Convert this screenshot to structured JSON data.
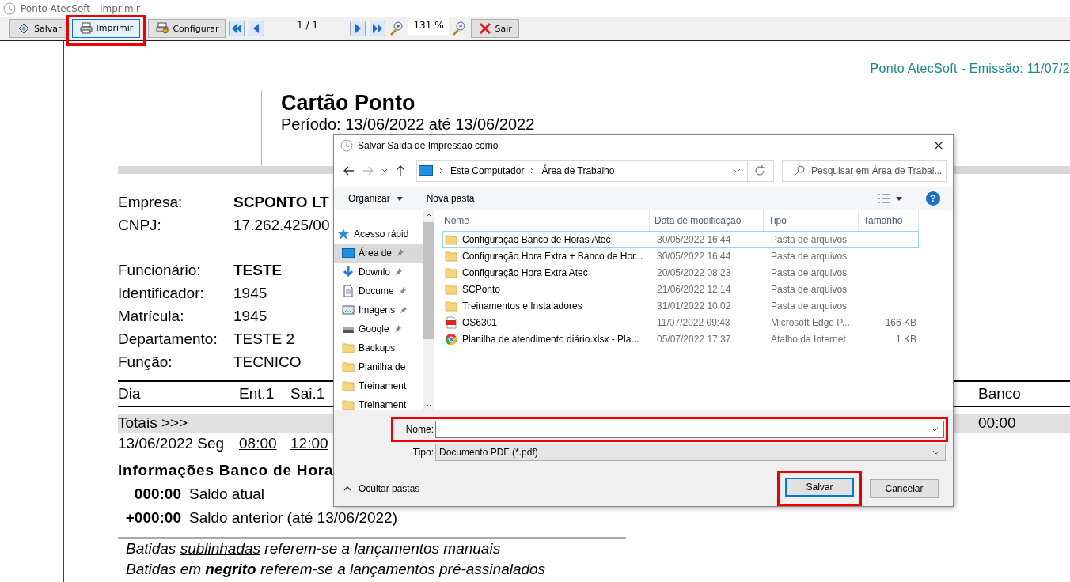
{
  "window": {
    "title": "Ponto AtecSoft - Imprimir"
  },
  "toolbar": [
    {
      "kind": "save",
      "label": "Salvar",
      "selected": false,
      "highlighted": false
    },
    {
      "kind": "print",
      "label": "Imprimir",
      "selected": true,
      "highlighted": true
    },
    {
      "kind": "configure",
      "label": "Configurar",
      "selected": false,
      "highlighted": false
    },
    {
      "kind": "first"
    },
    {
      "kind": "previous"
    },
    {
      "kind": "counter",
      "label": "1 / 1"
    },
    {
      "kind": "next"
    },
    {
      "kind": "last"
    },
    {
      "kind": "zoom_in"
    },
    {
      "kind": "zoom_level",
      "label": "131 %"
    },
    {
      "kind": "zoom_out"
    },
    {
      "kind": "exit",
      "label": "Sair",
      "selected": false,
      "highlighted": false
    }
  ],
  "report": {
    "emission": "Ponto AtecSoft - Emissão: 11/07/2",
    "title": "Cartão Ponto",
    "period": "Período: 13/06/2022 até 13/06/2022",
    "company": [
      {
        "label": "Empresa:",
        "value": "SCPONTO LT",
        "bold": true
      },
      {
        "label": "CNPJ:",
        "value": "17.262.425/00",
        "bold": false
      }
    ],
    "employee": [
      {
        "label": "Funcionário:",
        "value": "TESTE",
        "bold": true
      },
      {
        "label": "Identificador:",
        "value": "1945",
        "bold": false
      },
      {
        "label": "Matrícula:",
        "value": "1945",
        "bold": false
      },
      {
        "label": "Departamento:",
        "value": "TESTE 2",
        "bold": false
      },
      {
        "label": "Função:",
        "value": "TECNICO",
        "bold": false
      }
    ],
    "columns": [
      "Dia",
      "Ent.1",
      "Sai.1",
      "Banco"
    ],
    "totals": {
      "label": "Totais >>>",
      "bank": "00:00"
    },
    "rows": [
      {
        "day": "13/06/2022 Seg",
        "punches": [
          {
            "time": "08:00",
            "manual": true
          },
          {
            "time": "12:00",
            "manual": true
          }
        ]
      }
    ],
    "bank_heading": "Informações Banco de Hora",
    "balances": [
      {
        "amount": "000:00",
        "description": "Saldo atual"
      },
      {
        "amount": "+000:00",
        "description": "Saldo anterior (até 13/06/2022)"
      }
    ],
    "legend": [
      [
        {
          "text": "Batidas ",
          "underline": false
        },
        {
          "text": "sublinhadas",
          "underline": true
        },
        {
          "text": " referem-se a lançamentos manuais",
          "underline": false
        }
      ],
      [
        {
          "text": "Batidas em **negrito** referem-se a lançamentos pré-assinalados",
          "underline": false
        }
      ]
    ]
  },
  "dialog": {
    "title": "Salvar Saída de Impressão como",
    "path": [
      "Este Computador",
      "Área de Trabalho"
    ],
    "search": {
      "placeholder": "Pesquisar em Área de Trabal..."
    },
    "commands": [
      "Organizar",
      "Nova pasta"
    ],
    "help": "?",
    "nav": [
      {
        "kind": "quick_access",
        "label": "Acesso rápid",
        "pinned": false,
        "selected": false
      },
      {
        "kind": "desktop",
        "label": "Área de",
        "pinned": true,
        "selected": true
      },
      {
        "kind": "downloads",
        "label": "Downlo",
        "pinned": true,
        "selected": false
      },
      {
        "kind": "documents",
        "label": "Docume",
        "pinned": true,
        "selected": false
      },
      {
        "kind": "pictures",
        "label": "Imagens",
        "pinned": true,
        "selected": false
      },
      {
        "kind": "drive",
        "label": "Google",
        "pinned": true,
        "selected": false
      },
      {
        "kind": "folder",
        "label": "Backups",
        "pinned": false,
        "selected": false
      },
      {
        "kind": "folder",
        "label": "Planilha de",
        "pinned": false,
        "selected": false
      },
      {
        "kind": "folder",
        "label": "Treinament",
        "pinned": false,
        "selected": false
      },
      {
        "kind": "folder",
        "label": "Treinament",
        "pinned": false,
        "selected": false
      }
    ],
    "columns": [
      "Nome",
      "Data de modificação",
      "Tipo",
      "Tamanho"
    ],
    "files": [
      {
        "kind": "folder",
        "name": "Configuração Banco de Horas Atec",
        "date": "30/05/2022 16:44",
        "type": "Pasta de arquivos",
        "selected": true
      },
      {
        "kind": "folder",
        "name": "Configuração Hora Extra + Banco de Hor...",
        "date": "30/05/2022 16:44",
        "type": "Pasta de arquivos",
        "selected": false
      },
      {
        "kind": "folder",
        "name": "Configuração Hora Extra Atec",
        "date": "20/05/2022 08:23",
        "type": "Pasta de arquivos",
        "selected": false
      },
      {
        "kind": "folder",
        "name": "SCPonto",
        "date": "21/06/2022 12:14",
        "type": "Pasta de arquivos",
        "selected": false
      },
      {
        "kind": "folder",
        "name": "Treinamentos e Instaladores",
        "date": "31/01/2022 10:02",
        "type": "Pasta de arquivos",
        "selected": false
      },
      {
        "kind": "pdf",
        "name": "OS6301",
        "date": "11/07/2022 09:43",
        "type": "Microsoft Edge P...",
        "size": "166 KB",
        "selected": false
      },
      {
        "kind": "web",
        "name": "Planilha de atendimento diário.xlsx - Pla...",
        "date": "05/07/2022 17:37",
        "type": "Atalho da Internet",
        "size": "1 KB",
        "selected": false
      }
    ],
    "name_field": {
      "label": "Nome:",
      "highlighted": true
    },
    "type_field": {
      "label": "Tipo:",
      "value": "Documento PDF (*.pdf)"
    },
    "hide_folders": "Ocultar pastas",
    "buttons": [
      {
        "label": "Salvar",
        "default": true,
        "highlighted": true
      },
      {
        "label": "Cancelar",
        "default": false,
        "highlighted": false
      }
    ]
  }
}
